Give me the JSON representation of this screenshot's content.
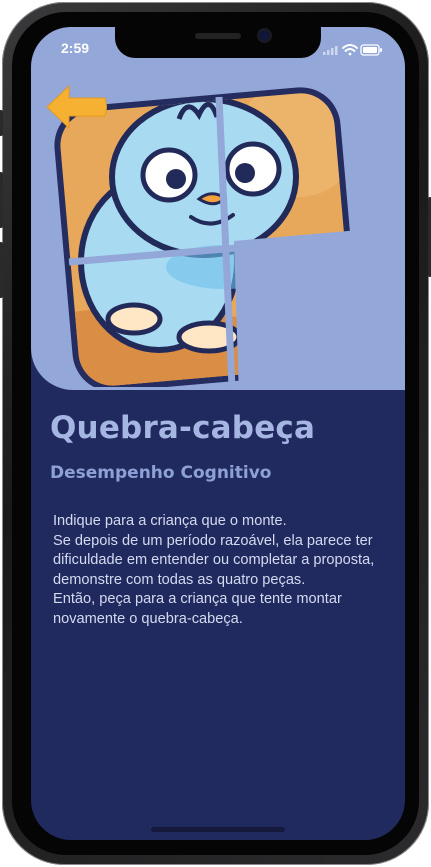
{
  "status_bar": {
    "time": "2:59"
  },
  "screen": {
    "title": "Quebra-cabeça",
    "subtitle": "Desempenho Cognitivo",
    "description": "Indique para a criança que o monte.\nSe depois de um período razoável, ela parece ter dificuldade em entender ou completar a proposta, demonstre com todas as quatro peças.\nEntão, peça para a criança que tente montar novamente o quebra-cabeça."
  },
  "icons": {
    "back": "arrow-left-icon",
    "wifi": "wifi-icon",
    "battery": "battery-icon",
    "signal": "signal-icon"
  },
  "colors": {
    "hero_background": "#93a7d8",
    "body_background": "#212a5e",
    "title": "#a5b6e3",
    "subtitle": "#8ea1d7",
    "text": "#d3daf0",
    "back_arrow": "#f6b133"
  }
}
